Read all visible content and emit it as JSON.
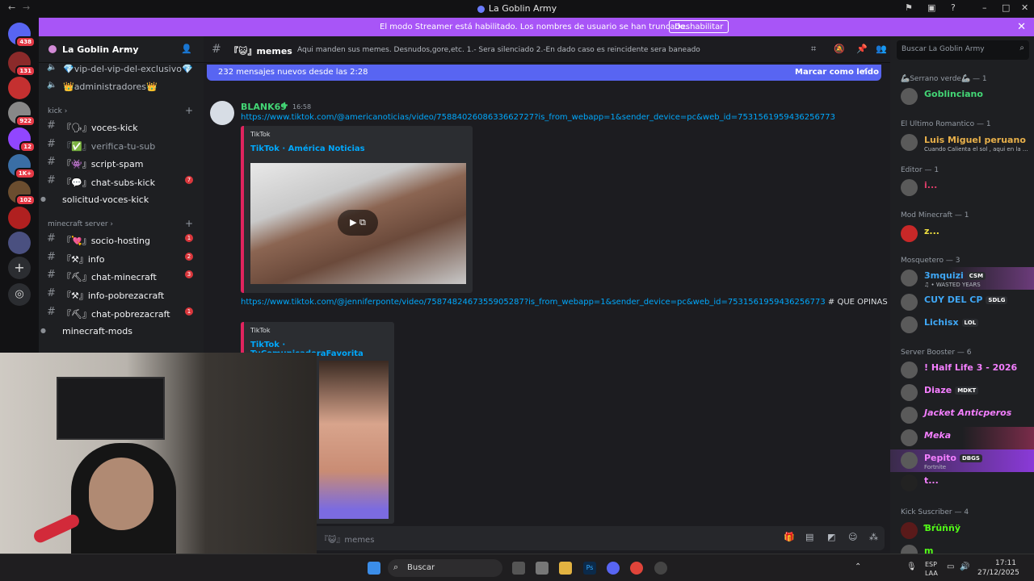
{
  "window": {
    "title": "La Goblin Army"
  },
  "banner": {
    "message": "El modo Streamer está habilitado. Los nombres de usuario se han truncado.",
    "button": "Deshabilitar"
  },
  "rail": {
    "badges": [
      "438",
      "131",
      "922",
      "12",
      "1K+",
      "102"
    ]
  },
  "server": {
    "name": "La Goblin Army"
  },
  "channels": {
    "top": [
      {
        "name": "💎vip-del-vip-del-exclusivo💎"
      },
      {
        "name": "👑administradores👑"
      }
    ],
    "cat_kick": "kick",
    "kick": [
      {
        "name": "『🗣』voces-kick"
      },
      {
        "name": "『✅』verifica-tu-sub"
      },
      {
        "name": "『👾』script-spam"
      },
      {
        "name": "『💬』chat-subs-kick",
        "count": "7"
      },
      {
        "name": "solicitud-voces-kick"
      }
    ],
    "cat_mc": "minecraft server",
    "mc": [
      {
        "name": "『💘』socio-hosting",
        "count": "1"
      },
      {
        "name": "『⚒』info",
        "count": "2"
      },
      {
        "name": "『⛏』chat-minecraft",
        "count": "3"
      },
      {
        "name": "『⚒』info-pobrezacraft"
      },
      {
        "name": "『⛏』chat-pobrezacraft",
        "count": "1"
      },
      {
        "name": "minecraft-mods"
      }
    ]
  },
  "chat": {
    "channel": "『😺』memes",
    "topic": "Aqui manden sus memes. Desnudos,gore,etc. 1.- Sera silenciado 2.-En dado caso es reincidente sera baneado",
    "search_placeholder": "Buscar La Goblin Army",
    "new_messages": "232 mensajes nuevos desde las 2:28",
    "mark_read": "Marcar como leído",
    "message": {
      "author": "BLANK69",
      "time": "16:58",
      "link1": "https://www.tiktok.com/@americanoticias/video/7588402608633662727?is_from_webapp=1&sender_device=pc&web_id=7531561959436256773",
      "embed1": {
        "provider": "TikTok",
        "title": "TikTok · América Noticias"
      },
      "link2": "https://www.tiktok.com/@jenniferponte/video/7587482467355905287?is_from_webapp=1&sender_device=pc&web_id=7531561959436256773",
      "text2": " # QUE OPINAS DE MI FLAQUITA",
      "embed2": {
        "provider": "TikTok",
        "title": "TikTok · TuComunicadoraFavorita"
      }
    },
    "input_placeholder": "『😺』memes"
  },
  "members": {
    "groups": [
      {
        "label": "🦾Serrano verde🦾 — 1",
        "members": [
          {
            "name": "Goblinciano",
            "color": "#43d675"
          }
        ]
      },
      {
        "label": "El Ultimo Romantico — 1",
        "members": [
          {
            "name": "Luis Miguel peruano",
            "color": "#e8b04a",
            "sub": "Cuando Calienta el sol , aqui en la ..."
          }
        ]
      },
      {
        "label": "Editor — 1",
        "members": [
          {
            "name": "i...",
            "color": "#e03d6a"
          }
        ]
      },
      {
        "label": "Mod Minecraft — 1",
        "members": [
          {
            "name": "z...",
            "color": "#f0e040"
          }
        ]
      },
      {
        "label": "Mosquetero — 3",
        "members": [
          {
            "name": "3mquizi",
            "color": "#3fa7f5",
            "tag": "CSM",
            "sub": "♫ • WASTED YEARS"
          },
          {
            "name": "CUY DEL CP",
            "color": "#3fa7f5",
            "tag": "SDLG"
          },
          {
            "name": "Lichisx",
            "color": "#3fa7f5",
            "tag": "LOL"
          }
        ]
      },
      {
        "label": "Server Booster — 6",
        "members": [
          {
            "name": "! Half Life 3 - 2026",
            "color": "#f47fff"
          },
          {
            "name": "Diaze",
            "color": "#f47fff",
            "tag": "MDKT"
          },
          {
            "name": "Jacket Anticperos",
            "color": "#f47fff"
          },
          {
            "name": "Meka",
            "color": "#f47fff"
          },
          {
            "name": "Pepito",
            "color": "#f47fff",
            "tag": "DBGS",
            "sub": "Fortnite"
          },
          {
            "name": "t...",
            "color": "#f47fff"
          }
        ]
      },
      {
        "label": "Kick Suscriber — 4",
        "members": [
          {
            "name": "Ɓŕûññÿ",
            "color": "#53fc18"
          },
          {
            "name": "m",
            "color": "#53fc18"
          }
        ]
      }
    ]
  },
  "taskbar": {
    "search": "Buscar",
    "lang": "ESP",
    "lang2": "LAA",
    "time": "17:11",
    "date": "27/12/2025"
  }
}
